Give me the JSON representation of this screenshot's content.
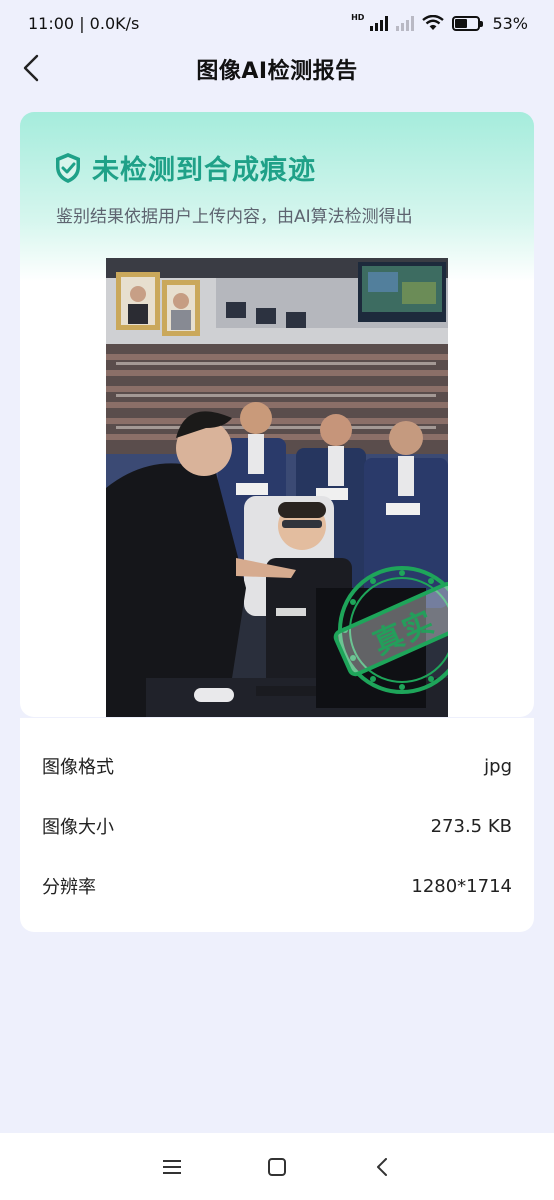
{
  "status_bar": {
    "time_speed": "11:00 | 0.0K/s",
    "battery_text": "53%",
    "battery_level": 0.53,
    "network_label": "HD"
  },
  "header": {
    "title": "图像AI检测报告",
    "back_icon": "chevron-left-icon"
  },
  "result": {
    "title": "未检测到合成痕迹",
    "subtitle": "鉴别结果依据用户上传内容，由AI算法检测得出",
    "icon": "shield-check-icon",
    "stamp_text": "真实",
    "accent_color": "#1fa188",
    "stamp_color": "#1ea55a"
  },
  "info": {
    "rows": [
      {
        "label": "图像格式",
        "value": "jpg"
      },
      {
        "label": "图像大小",
        "value": "273.5 KB"
      },
      {
        "label": "分辨率",
        "value": "1280*1714"
      }
    ]
  },
  "nav": {
    "menu_icon": "menu-icon",
    "home_icon": "home-square-icon",
    "back_icon": "back-triangle-icon"
  }
}
